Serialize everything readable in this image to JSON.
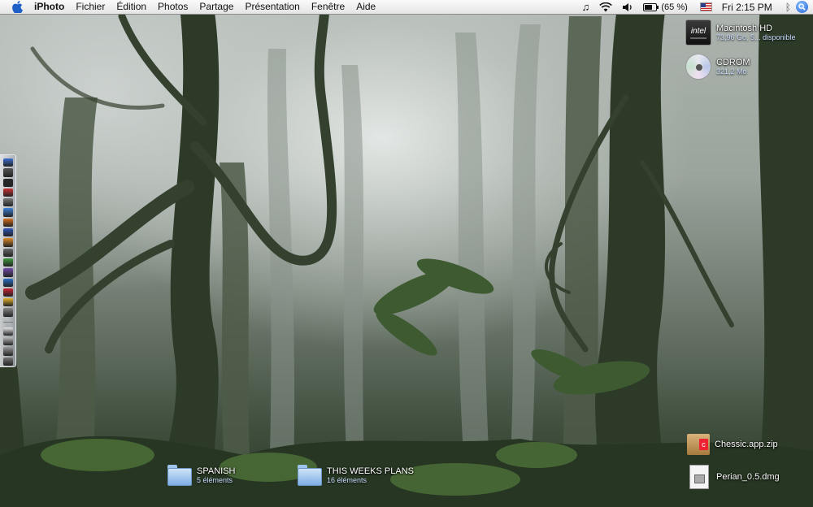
{
  "menubar": {
    "app_name": "iPhoto",
    "menus": [
      "Fichier",
      "Édition",
      "Photos",
      "Partage",
      "Présentation",
      "Fenêtre",
      "Aide"
    ],
    "battery": "(65 %)",
    "clock": "Fri 2:15 PM"
  },
  "desktop": {
    "volumes": [
      {
        "name": "Macintosh HD",
        "info": "73,96 Go, 5... disponible",
        "icon_label": "intel"
      },
      {
        "name": "CDROM",
        "info": "321,2 Mo"
      }
    ],
    "files": [
      {
        "name": "Chessic.app.zip"
      },
      {
        "name": "Perian_0.5.dmg"
      }
    ],
    "folders": [
      {
        "name": "SPANISH",
        "info": "5 éléments"
      },
      {
        "name": "THIS WEEKS PLANS",
        "info": "16 éléments"
      }
    ]
  },
  "dock": {
    "colors": [
      "#3b6fd0",
      "#555",
      "#2a2a2a",
      "#cc3333",
      "#7a7a7a",
      "#3d80d8",
      "#d9701e",
      "#2f58b8",
      "#e08b2a",
      "#6a6a6a",
      "#3e9a3e",
      "#6f4aa8",
      "#2b6fc9",
      "#c23",
      "#e6b32d",
      "#888",
      "#e8e8e8",
      "#bbb",
      "#999",
      "#777"
    ]
  },
  "colors": {
    "menubar_bg": "#f0f0f0",
    "label_sub": "#c9dcff"
  }
}
